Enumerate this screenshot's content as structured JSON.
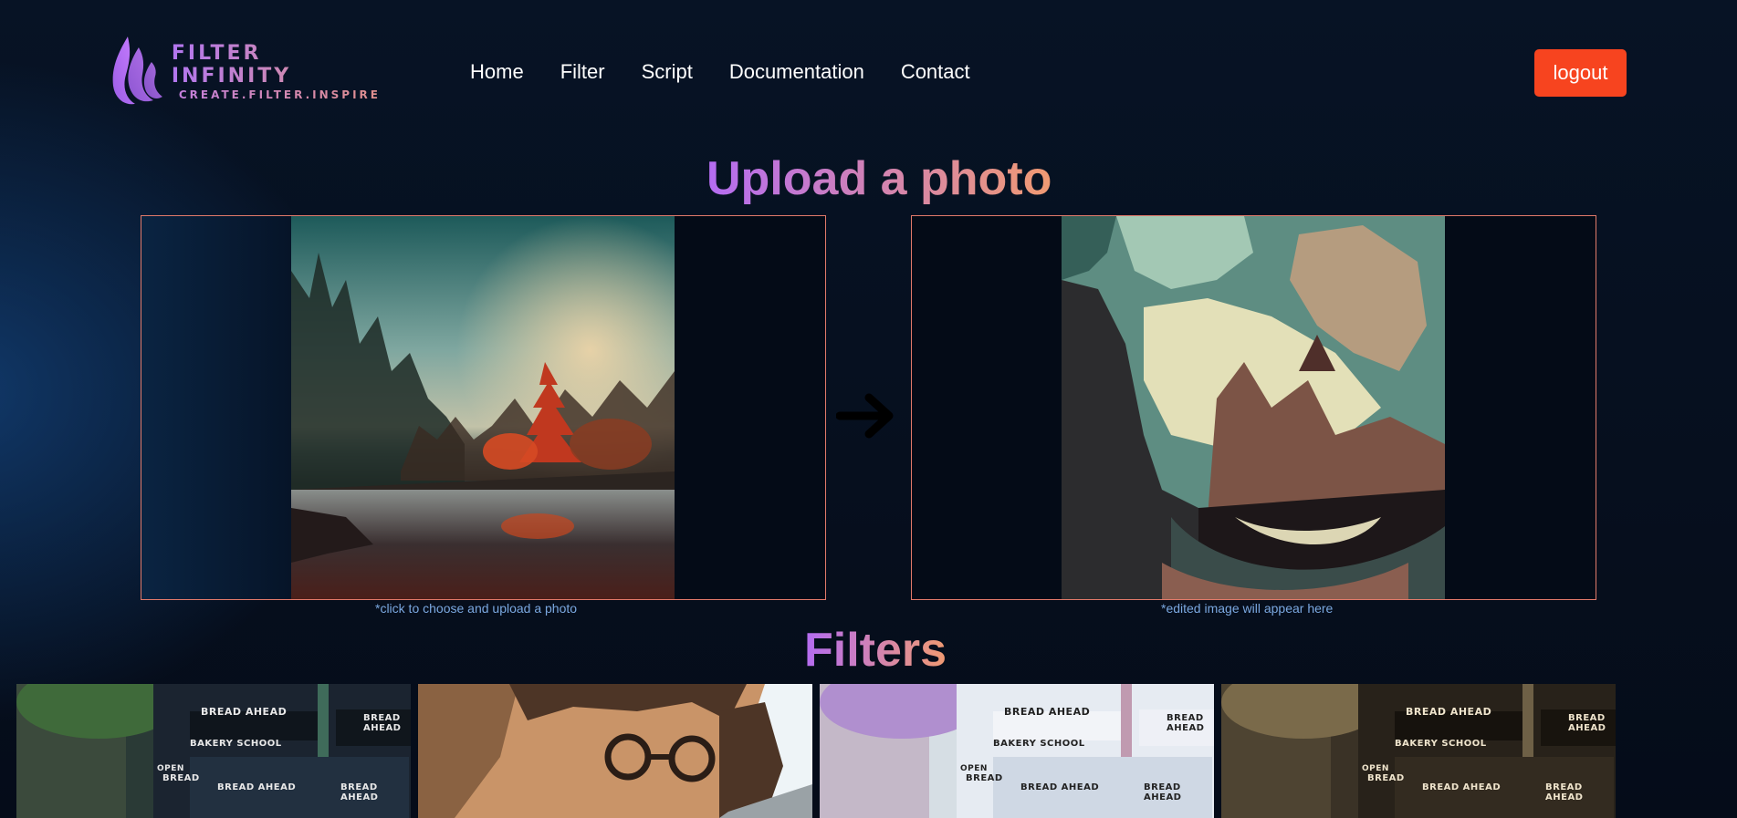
{
  "brand": {
    "name": "FILTER INFINITY",
    "tagline": "CREATE.FILTER.INSPIRE",
    "icon": "flame-logo-icon"
  },
  "nav": {
    "items": [
      {
        "label": "Home"
      },
      {
        "label": "Filter"
      },
      {
        "label": "Script"
      },
      {
        "label": "Documentation"
      },
      {
        "label": "Contact"
      }
    ]
  },
  "header": {
    "logout_label": "logout"
  },
  "upload": {
    "title": "Upload a photo",
    "input_caption": "*click to choose and upload a photo",
    "output_caption": "*edited image will appear here",
    "arrow_icon": "arrow-right-icon"
  },
  "filters": {
    "title": "Filters",
    "thumbnails": [
      {
        "name": "filter-original",
        "signs": [
          "BREAD AHEAD",
          "BAKERY SCHOOL",
          "BREAD",
          "BREAD AHEAD",
          "BREAD AHEAD",
          "OPEN"
        ]
      },
      {
        "name": "filter-posterize-portrait"
      },
      {
        "name": "filter-invert",
        "signs": [
          "BREAD AHEAD",
          "BAKERY SCHOOL",
          "BREAD",
          "BREAD AHEAD",
          "BREAD AHEAD",
          "OPEN"
        ]
      },
      {
        "name": "filter-sepia",
        "signs": [
          "BREAD AHEAD",
          "BAKERY SCHOOL",
          "BREAD",
          "BREAD AHEAD",
          "BREAD AHEAD",
          "OPEN"
        ]
      }
    ]
  },
  "colors": {
    "accent_orange": "#f7441f",
    "panel_border": "#e17a6a",
    "gradient_start": "#b46cf2",
    "gradient_end": "#f09a72",
    "caption": "#7ba8e0"
  }
}
